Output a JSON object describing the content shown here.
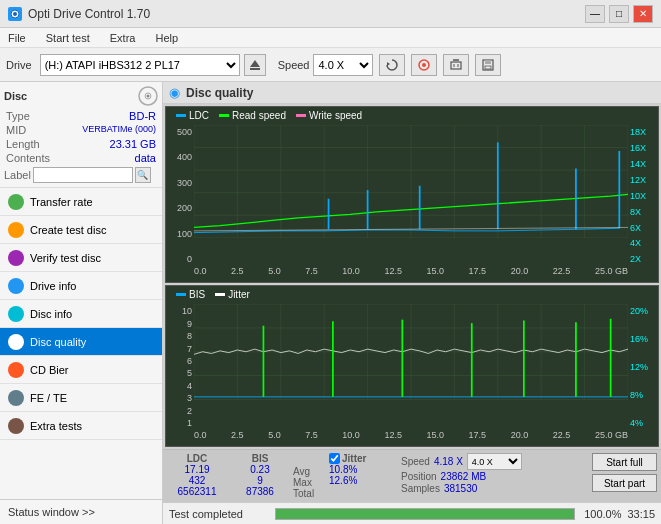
{
  "titleBar": {
    "title": "Opti Drive Control 1.70",
    "minimizeLabel": "—",
    "maximizeLabel": "□",
    "closeLabel": "✕"
  },
  "menuBar": {
    "items": [
      "File",
      "Start test",
      "Extra",
      "Help"
    ]
  },
  "toolbar": {
    "driveLabel": "Drive",
    "driveValue": "(H:) ATAPI iHBS312  2 PL17",
    "speedLabel": "Speed",
    "speedValue": "4.0 X"
  },
  "sidebar": {
    "discSection": {
      "title": "Disc",
      "type": {
        "label": "Type",
        "value": "BD-R"
      },
      "mid": {
        "label": "MID",
        "value": "VERBATIMe (000)"
      },
      "length": {
        "label": "Length",
        "value": "23.31 GB"
      },
      "contents": {
        "label": "Contents",
        "value": "data"
      },
      "labelLabel": "Label"
    },
    "navItems": [
      {
        "id": "transfer-rate",
        "label": "Transfer rate",
        "active": false
      },
      {
        "id": "create-test-disc",
        "label": "Create test disc",
        "active": false
      },
      {
        "id": "verify-test-disc",
        "label": "Verify test disc",
        "active": false
      },
      {
        "id": "drive-info",
        "label": "Drive info",
        "active": false
      },
      {
        "id": "disc-info",
        "label": "Disc info",
        "active": false
      },
      {
        "id": "disc-quality",
        "label": "Disc quality",
        "active": true
      },
      {
        "id": "cd-bier",
        "label": "CD Bier",
        "active": false
      },
      {
        "id": "fe-te",
        "label": "FE / TE",
        "active": false
      },
      {
        "id": "extra-tests",
        "label": "Extra tests",
        "active": false
      }
    ],
    "statusWindow": "Status window >>"
  },
  "content": {
    "title": "Disc quality",
    "chart1": {
      "legend": [
        {
          "label": "LDC",
          "color": "#00aaff"
        },
        {
          "label": "Read speed",
          "color": "#00ff00"
        },
        {
          "label": "Write speed",
          "color": "#ff69b4"
        }
      ],
      "yAxisLeft": [
        "500",
        "400",
        "300",
        "200",
        "100",
        "0"
      ],
      "yAxisRight": [
        "18X",
        "16X",
        "14X",
        "12X",
        "10X",
        "8X",
        "6X",
        "4X",
        "2X"
      ],
      "xAxis": [
        "0.0",
        "2.5",
        "5.0",
        "7.5",
        "10.0",
        "12.5",
        "15.0",
        "17.5",
        "20.0",
        "22.5",
        "25.0"
      ],
      "xUnit": "GB"
    },
    "chart2": {
      "legend": [
        {
          "label": "BIS",
          "color": "#00aaff"
        },
        {
          "label": "Jitter",
          "color": "white"
        }
      ],
      "yAxisLeft": [
        "10",
        "9",
        "8",
        "7",
        "6",
        "5",
        "4",
        "3",
        "2",
        "1"
      ],
      "yAxisRight": [
        "20%",
        "16%",
        "12%",
        "8%",
        "4%"
      ],
      "xAxis": [
        "0.0",
        "2.5",
        "5.0",
        "7.5",
        "10.0",
        "12.5",
        "15.0",
        "17.5",
        "20.0",
        "22.5",
        "25.0"
      ],
      "xUnit": "GB"
    }
  },
  "stats": {
    "ldcLabel": "LDC",
    "bisLabel": "BIS",
    "jitterLabel": "Jitter",
    "jitterChecked": true,
    "speedLabel": "Speed",
    "speedValue": "4.18 X",
    "speedSelect": "4.0 X",
    "rows": {
      "avg": {
        "label": "Avg",
        "ldc": "17.19",
        "bis": "0.23",
        "jitter": "10.8%"
      },
      "max": {
        "label": "Max",
        "ldc": "432",
        "bis": "9",
        "jitter": "12.6%"
      },
      "total": {
        "label": "Total",
        "ldc": "6562311",
        "bis": "87386"
      }
    },
    "positionLabel": "Position",
    "positionValue": "23862 MB",
    "samplesLabel": "Samples",
    "samplesValue": "381530",
    "startFullLabel": "Start full",
    "startPartLabel": "Start part"
  },
  "bottomBar": {
    "statusText": "Test completed",
    "progressPct": "100.0%",
    "timeText": "33:15"
  }
}
